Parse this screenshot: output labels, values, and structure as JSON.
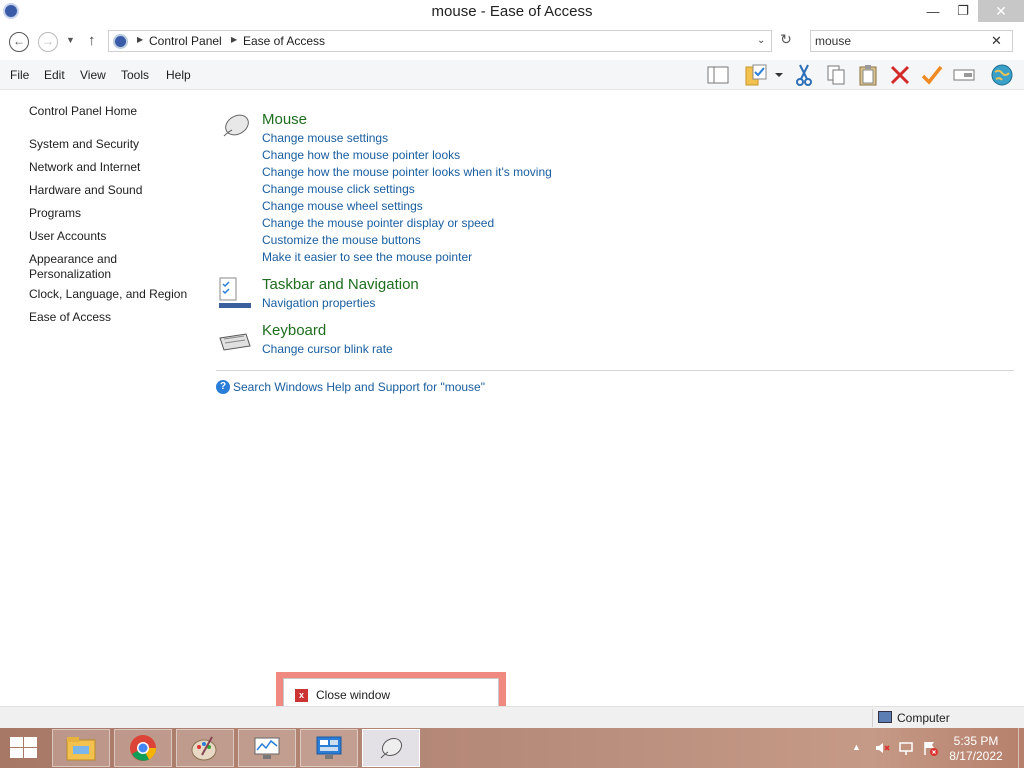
{
  "window": {
    "title": "mouse - Ease of Access",
    "buttons": {
      "minimize": "—",
      "maximize": "❐",
      "close": "✕"
    }
  },
  "address": {
    "breadcrumbs": [
      "Control Panel",
      "Ease of Access"
    ],
    "search_value": "mouse"
  },
  "menu": [
    "File",
    "Edit",
    "View",
    "Tools",
    "Help"
  ],
  "toolbar_icons": [
    "layout-pane-icon",
    "folder-properties-icon",
    "dropdown-arrow-icon",
    "cut-icon",
    "copy-icon",
    "paste-icon",
    "delete-icon",
    "check-icon",
    "rename-icon",
    "globe-icon"
  ],
  "leftnav": {
    "home": "Control Panel Home",
    "items": [
      "System and Security",
      "Network and Internet",
      "Hardware and Sound",
      "Programs",
      "User Accounts",
      "Appearance and Personalization",
      "Clock, Language, and Region",
      "Ease of Access"
    ]
  },
  "results": [
    {
      "title": "Mouse",
      "icon": "mouse-icon",
      "links": [
        "Change mouse settings",
        "Change how the mouse pointer looks",
        "Change how the mouse pointer looks when it's moving",
        "Change mouse click settings",
        "Change mouse wheel settings",
        "Change the mouse pointer display or speed",
        "Customize the mouse buttons",
        "Make it easier to see the mouse pointer"
      ]
    },
    {
      "title": "Taskbar and Navigation",
      "icon": "taskbar-icon",
      "links": [
        "Navigation properties"
      ]
    },
    {
      "title": "Keyboard",
      "icon": "keyboard-icon",
      "links": [
        "Change cursor blink rate"
      ]
    }
  ],
  "help_link": "Search Windows Help and Support for \"mouse\"",
  "tooltip": {
    "label": "Close window"
  },
  "status": {
    "computer": "Computer"
  },
  "taskbar": {
    "apps": [
      "file-explorer-icon",
      "chrome-icon",
      "paint-icon",
      "performance-monitor-icon",
      "remote-desktop-icon",
      "mouse-icon"
    ],
    "clock_time": "5:35 PM",
    "clock_date": "8/17/2022"
  },
  "colors": {
    "link": "#1a5ea0",
    "section_title": "#1e6e1e",
    "taskbar": "#b78b7a",
    "tooltip_border": "#f08a80"
  }
}
